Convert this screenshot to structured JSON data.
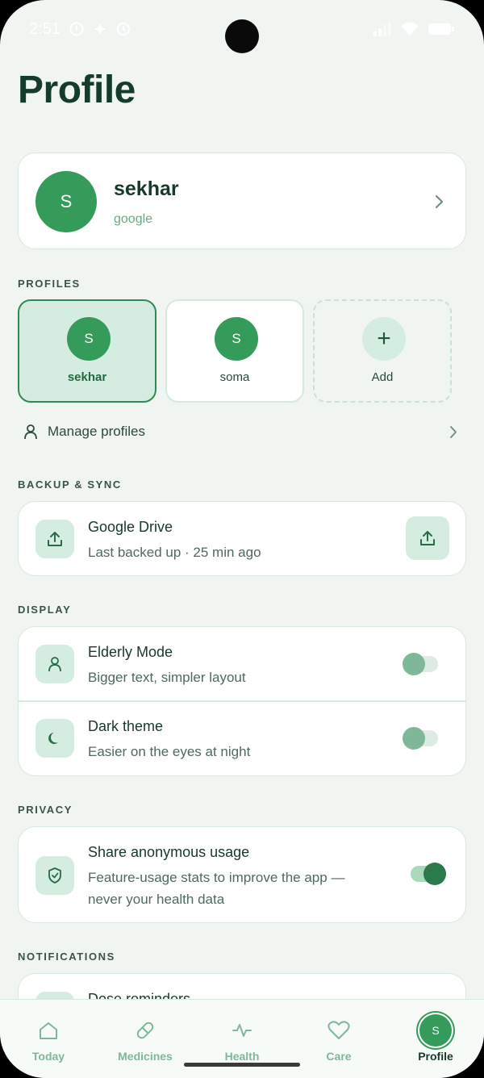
{
  "status_bar": {
    "time": "2:51"
  },
  "page": {
    "title": "Profile"
  },
  "user": {
    "initial": "S",
    "name": "sekhar",
    "account": "google"
  },
  "sections": {
    "profiles": "PROFILES",
    "backup": "BACKUP & SYNC",
    "display": "DISPLAY",
    "privacy": "PRIVACY",
    "notifications": "NOTIFICATIONS"
  },
  "profiles": [
    {
      "initial": "S",
      "name": "sekhar",
      "active": true
    },
    {
      "initial": "S",
      "name": "soma",
      "active": false
    },
    {
      "initial": "+",
      "name": "Add",
      "active": false
    }
  ],
  "manage_profiles": "Manage profiles",
  "backup": {
    "title": "Google Drive",
    "subtitle": "Last backed up · 25 min ago"
  },
  "display": {
    "elderly": {
      "title": "Elderly Mode",
      "subtitle": "Bigger text, simpler layout",
      "enabled": false
    },
    "dark": {
      "title": "Dark theme",
      "subtitle": "Easier on the eyes at night",
      "enabled": false
    }
  },
  "privacy": {
    "share": {
      "title": "Share anonymous usage",
      "subtitle_line1": "Feature-usage stats to improve the app —",
      "subtitle_line2": "never your health data",
      "enabled": true
    }
  },
  "notifications": {
    "first_item": "Dose reminders"
  },
  "nav": [
    {
      "label": "Today",
      "icon": "home-icon"
    },
    {
      "label": "Medicines",
      "icon": "pill-icon"
    },
    {
      "label": "Health",
      "icon": "pulse-icon"
    },
    {
      "label": "Care",
      "icon": "heart-icon"
    },
    {
      "label": "Profile",
      "icon": "avatar",
      "initial": "S",
      "active": true
    }
  ],
  "colors": {
    "accent": "#349b5b",
    "dark_text": "#143c2a",
    "background": "#f0f5f1"
  }
}
